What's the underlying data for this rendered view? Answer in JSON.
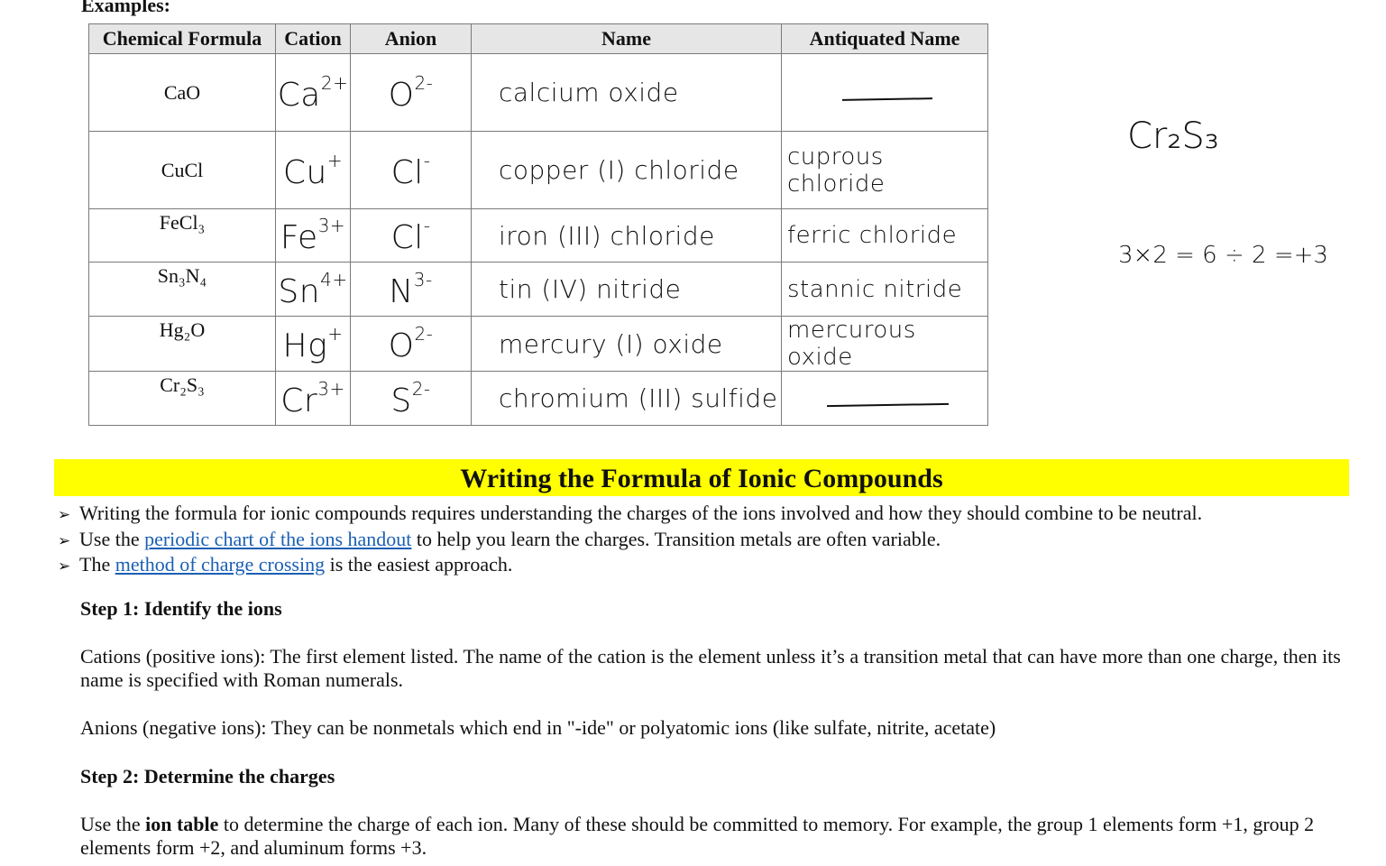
{
  "examples_heading": "Examples:",
  "table": {
    "headers": [
      "Chemical Formula",
      "Cation",
      "Anion",
      "Name",
      "Antiquated Name"
    ],
    "rows": [
      {
        "formula": "CaO",
        "cation_symbol": "Ca",
        "cation_charge": "2+",
        "anion_symbol": "O",
        "anion_charge": "2-",
        "name": "calcium oxide",
        "antiquated": ""
      },
      {
        "formula": "CuCl",
        "cation_symbol": "Cu",
        "cation_charge": "+",
        "anion_symbol": "Cl",
        "anion_charge": "-",
        "name": "copper (I) chloride",
        "antiquated": "cuprous chloride"
      },
      {
        "formula": "FeCl₃",
        "cation_symbol": "Fe",
        "cation_charge": "3+",
        "anion_symbol": "Cl",
        "anion_charge": "-",
        "name": "iron (III) chloride",
        "antiquated": "ferric chloride"
      },
      {
        "formula": "Sn₃N₄",
        "cation_symbol": "Sn",
        "cation_charge": "4+",
        "anion_symbol": "N",
        "anion_charge": "3-",
        "name": "tin (IV) nitride",
        "antiquated": "stannic nitride"
      },
      {
        "formula": "Hg₂O",
        "cation_symbol": "Hg",
        "cation_charge": "+",
        "anion_symbol": "O",
        "anion_charge": "2-",
        "name": "mercury (I) oxide",
        "antiquated": "mercurous oxide"
      },
      {
        "formula": "Cr₂S₃",
        "cation_symbol": "Cr",
        "cation_charge": "3+",
        "anion_symbol": "S",
        "anion_charge": "2-",
        "name": "chromium (III) sulfide",
        "antiquated": ""
      }
    ]
  },
  "side_notes": {
    "formula": "Cr₂S₃",
    "calc": "3×2 = 6 ÷ 2 =+3"
  },
  "section_title": "Writing the Formula of Ionic Compounds",
  "bullets": {
    "b1": "Writing the formula for ionic compounds requires understanding the charges of the ions involved and how they should combine to be neutral.",
    "b2_pre": "Use the ",
    "b2_link": "periodic chart of the ions handout",
    "b2_post": " to help you learn the charges. Transition metals are often variable.",
    "b3_pre": "The ",
    "b3_link": "method of charge crossing",
    "b3_post": " is the easiest approach."
  },
  "step1": {
    "heading": "Step 1: Identify the ions",
    "cations": "Cations (positive ions): The first element listed. The name of the cation is the element unless it’s a transition metal that can have more than one charge, then its name is specified with Roman numerals.",
    "anions": "Anions (negative ions): They can be nonmetals which end in \"-ide\" or polyatomic ions (like sulfate, nitrite, acetate)"
  },
  "step2": {
    "heading": "Step 2: Determine the charges",
    "pre": "Use the ",
    "bold": "ion table",
    "post": " to determine the charge of each ion. Many of these should be committed to memory. For example, the group 1 elements form +1, group 2 elements form +2, and aluminum forms +3."
  }
}
